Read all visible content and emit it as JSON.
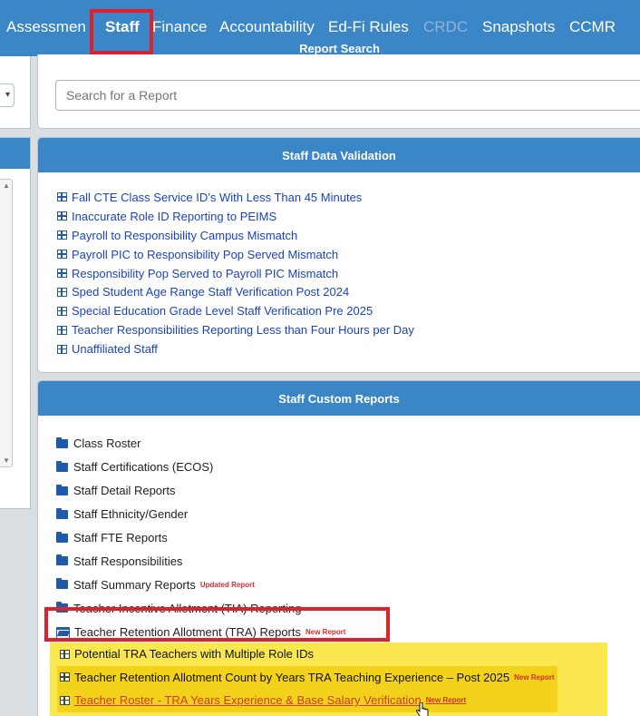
{
  "nav": {
    "items": [
      {
        "label": "Assessmen",
        "state": "normal"
      },
      {
        "label": "Staff",
        "state": "active"
      },
      {
        "label": "Finance",
        "state": "normal"
      },
      {
        "label": "Accountability",
        "state": "normal"
      },
      {
        "label": "Ed-Fi Rules",
        "state": "normal"
      },
      {
        "label": "CRDC",
        "state": "disabled"
      },
      {
        "label": "Snapshots",
        "state": "normal"
      },
      {
        "label": "CCMR",
        "state": "normal"
      }
    ]
  },
  "report_search": {
    "title": "Report Search",
    "placeholder": "Search for a Report"
  },
  "staff_data_validation": {
    "title": "Staff Data Validation",
    "items": [
      "Fall CTE Class Service ID’s With Less Than 45 Minutes",
      "Inaccurate Role ID Reporting to PEIMS",
      "Payroll to Responsibility Campus Mismatch",
      "Payroll PIC to Responsibility Pop Served Mismatch",
      "Responsibility Pop Served to Payroll PIC Mismatch",
      "Sped Student Age Range Staff Verification Post 2024",
      "Special Education Grade Level Staff Verification Pre 2025",
      "Teacher Responsibilities Reporting Less than Four Hours per Day",
      "Unaffiliated Staff"
    ]
  },
  "staff_custom_reports": {
    "title": "Staff Custom Reports",
    "folders": [
      {
        "label": "Class Roster",
        "badge": ""
      },
      {
        "label": "Staff Certifications (ECOS)",
        "badge": ""
      },
      {
        "label": "Staff Detail Reports",
        "badge": ""
      },
      {
        "label": "Staff Ethnicity/Gender",
        "badge": ""
      },
      {
        "label": "Staff FTE Reports",
        "badge": ""
      },
      {
        "label": "Staff Responsibilities",
        "badge": ""
      },
      {
        "label": "Staff Summary Reports",
        "badge": "Updated Report"
      },
      {
        "label": "Teacher Incentive Allotment (TIA) Reporting",
        "badge": ""
      },
      {
        "label": "Teacher Retention Allotment (TRA) Reports",
        "badge": "New Report",
        "open": true
      }
    ],
    "tra_reports": [
      {
        "label": "Potential TRA Teachers with Multiple Role IDs",
        "badge": ""
      },
      {
        "label": "Teacher Retention Allotment Count by Years TRA Teaching Experience – Post 2025",
        "badge": "New Report"
      },
      {
        "label": "Teacher Roster - TRA Years Experience & Base Salary Verification",
        "badge": "New Report"
      }
    ]
  },
  "colors": {
    "nav_blue": "#3a86c7",
    "link_blue": "#1a44c0",
    "highlight_red": "#e0202a",
    "badge_red": "#d92b2b",
    "yellow": "#fbe74f"
  }
}
